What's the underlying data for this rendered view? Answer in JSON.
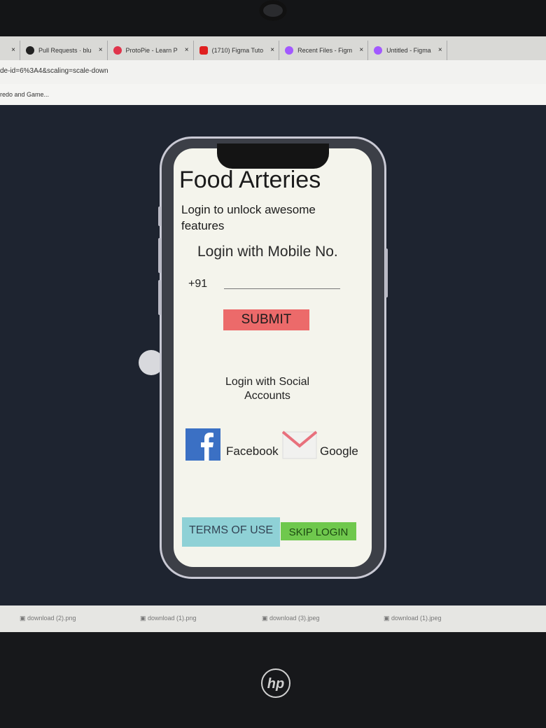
{
  "browser": {
    "tabs": [
      {
        "label": "Pull Requests · blu",
        "icon": "github-icon"
      },
      {
        "label": "ProtoPie - Learn P",
        "icon": "heart-icon"
      },
      {
        "label": "(1710) Figma Tuto",
        "icon": "youtube-icon"
      },
      {
        "label": "Recent Files - Figm",
        "icon": "figma-icon"
      },
      {
        "label": "Untitled - Figma",
        "icon": "figma-icon"
      }
    ],
    "url_fragment": "de-id=6%3A4&scaling=scale-down",
    "bookmark": "redo and Game..."
  },
  "app": {
    "title": "Food Arteries",
    "subtitle": "Login to unlock awesome features",
    "mobile_label": "Login with Mobile  No.",
    "country_code": "+91",
    "phone_value": "",
    "submit": "SUBMIT",
    "social_label": "Login with Social Accounts",
    "facebook": "Facebook",
    "google": "Google",
    "terms": "TERMS OF USE",
    "skip": "SKIP LOGIN"
  },
  "downloads": [
    "download (2).png",
    "download (1).png",
    "download (3).jpeg",
    "download (1).jpeg"
  ],
  "colors": {
    "submit": "#ec6a6a",
    "facebook": "#3b70c4",
    "terms": "#8fd1d6",
    "skip": "#6fc84d",
    "gmail": "#e8707c"
  },
  "icons": [
    "facebook-icon",
    "gmail-icon",
    "close-icon",
    "hp-logo"
  ]
}
